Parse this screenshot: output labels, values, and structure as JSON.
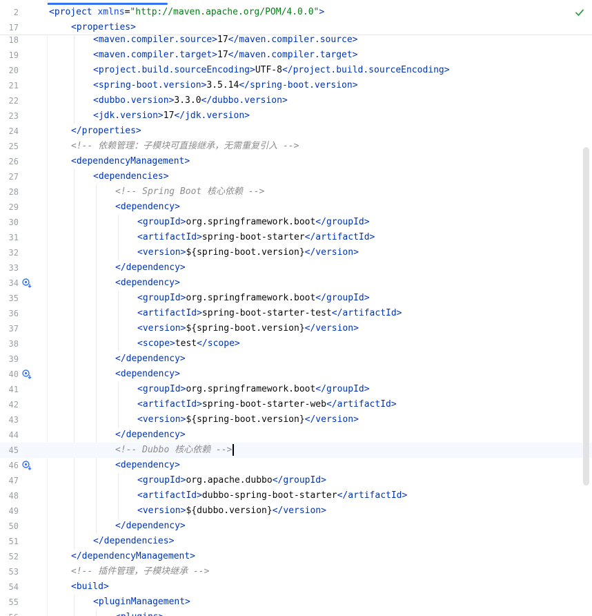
{
  "editor": {
    "status_icon": "check-icon",
    "sticky_lines": [
      {
        "number": "2",
        "indent": 0,
        "parts": [
          [
            "t",
            "<"
          ],
          [
            "t",
            "project"
          ],
          [
            "p",
            " "
          ],
          [
            "a",
            "xmlns"
          ],
          [
            "p",
            "="
          ],
          [
            "s",
            "\"http://maven.apache.org/POM/4.0.0\""
          ],
          [
            "t",
            ">"
          ]
        ]
      },
      {
        "number": "17",
        "indent": 1,
        "parts": [
          [
            "t",
            "<"
          ],
          [
            "t",
            "properties"
          ],
          [
            "t",
            ">"
          ]
        ]
      }
    ],
    "lines": [
      {
        "number": "18",
        "indent": 2,
        "parts": [
          [
            "t",
            "<maven.compiler.source>"
          ],
          [
            "p",
            "17"
          ],
          [
            "t",
            "</maven.compiler.source>"
          ]
        ]
      },
      {
        "number": "19",
        "indent": 2,
        "parts": [
          [
            "t",
            "<maven.compiler.target>"
          ],
          [
            "p",
            "17"
          ],
          [
            "t",
            "</maven.compiler.target>"
          ]
        ]
      },
      {
        "number": "20",
        "indent": 2,
        "parts": [
          [
            "t",
            "<project.build.sourceEncoding>"
          ],
          [
            "p",
            "UTF-8"
          ],
          [
            "t",
            "</project.build.sourceEncoding>"
          ]
        ]
      },
      {
        "number": "21",
        "indent": 2,
        "parts": [
          [
            "t",
            "<spring-boot.version>"
          ],
          [
            "p",
            "3.5.14"
          ],
          [
            "t",
            "</spring-boot.version>"
          ]
        ]
      },
      {
        "number": "22",
        "indent": 2,
        "parts": [
          [
            "t",
            "<dubbo.version>"
          ],
          [
            "p",
            "3.3.0"
          ],
          [
            "t",
            "</dubbo.version>"
          ]
        ]
      },
      {
        "number": "23",
        "indent": 2,
        "parts": [
          [
            "t",
            "<jdk.version>"
          ],
          [
            "p",
            "17"
          ],
          [
            "t",
            "</jdk.version>"
          ]
        ]
      },
      {
        "number": "24",
        "indent": 1,
        "parts": [
          [
            "t",
            "</properties>"
          ]
        ]
      },
      {
        "number": "25",
        "indent": 1,
        "parts": [
          [
            "c",
            "<!-- 依赖管理：子模块可直接继承，无需重复引入 -->"
          ]
        ]
      },
      {
        "number": "26",
        "indent": 1,
        "parts": [
          [
            "t",
            "<dependencyManagement>"
          ]
        ]
      },
      {
        "number": "27",
        "indent": 2,
        "parts": [
          [
            "t",
            "<dependencies>"
          ]
        ]
      },
      {
        "number": "28",
        "indent": 3,
        "parts": [
          [
            "c",
            "<!-- Spring Boot 核心依赖 -->"
          ]
        ]
      },
      {
        "number": "29",
        "indent": 3,
        "parts": [
          [
            "t",
            "<dependency>"
          ]
        ]
      },
      {
        "number": "30",
        "indent": 4,
        "parts": [
          [
            "t",
            "<groupId>"
          ],
          [
            "p",
            "org.springframework.boot"
          ],
          [
            "t",
            "</groupId>"
          ]
        ]
      },
      {
        "number": "31",
        "indent": 4,
        "parts": [
          [
            "t",
            "<artifactId>"
          ],
          [
            "p",
            "spring-boot-starter"
          ],
          [
            "t",
            "</artifactId>"
          ]
        ]
      },
      {
        "number": "32",
        "indent": 4,
        "parts": [
          [
            "t",
            "<version>"
          ],
          [
            "p",
            "${spring-boot.version}"
          ],
          [
            "t",
            "</version>"
          ]
        ]
      },
      {
        "number": "33",
        "indent": 3,
        "parts": [
          [
            "t",
            "</dependency>"
          ]
        ]
      },
      {
        "number": "34",
        "indent": 3,
        "gutter_icon": true,
        "parts": [
          [
            "t",
            "<dependency>"
          ]
        ]
      },
      {
        "number": "35",
        "indent": 4,
        "parts": [
          [
            "t",
            "<groupId>"
          ],
          [
            "p",
            "org.springframework.boot"
          ],
          [
            "t",
            "</groupId>"
          ]
        ]
      },
      {
        "number": "36",
        "indent": 4,
        "parts": [
          [
            "t",
            "<artifactId>"
          ],
          [
            "p",
            "spring-boot-starter-test"
          ],
          [
            "t",
            "</artifactId>"
          ]
        ]
      },
      {
        "number": "37",
        "indent": 4,
        "parts": [
          [
            "t",
            "<version>"
          ],
          [
            "p",
            "${spring-boot.version}"
          ],
          [
            "t",
            "</version>"
          ]
        ]
      },
      {
        "number": "38",
        "indent": 4,
        "parts": [
          [
            "t",
            "<scope>"
          ],
          [
            "p",
            "test"
          ],
          [
            "t",
            "</scope>"
          ]
        ]
      },
      {
        "number": "39",
        "indent": 3,
        "parts": [
          [
            "t",
            "</dependency>"
          ]
        ]
      },
      {
        "number": "40",
        "indent": 3,
        "gutter_icon": true,
        "parts": [
          [
            "t",
            "<dependency>"
          ]
        ]
      },
      {
        "number": "41",
        "indent": 4,
        "parts": [
          [
            "t",
            "<groupId>"
          ],
          [
            "p",
            "org.springframework.boot"
          ],
          [
            "t",
            "</groupId>"
          ]
        ]
      },
      {
        "number": "42",
        "indent": 4,
        "parts": [
          [
            "t",
            "<artifactId>"
          ],
          [
            "p",
            "spring-boot-starter-web"
          ],
          [
            "t",
            "</artifactId>"
          ]
        ]
      },
      {
        "number": "43",
        "indent": 4,
        "parts": [
          [
            "t",
            "<version>"
          ],
          [
            "p",
            "${spring-boot.version}"
          ],
          [
            "t",
            "</version>"
          ]
        ]
      },
      {
        "number": "44",
        "indent": 3,
        "parts": [
          [
            "t",
            "</dependency>"
          ]
        ]
      },
      {
        "number": "45",
        "indent": 3,
        "current": true,
        "parts": [
          [
            "c",
            "<!-- Dubbo 核心依赖 -->"
          ]
        ]
      },
      {
        "number": "46",
        "indent": 3,
        "gutter_icon": true,
        "parts": [
          [
            "t",
            "<dependency>"
          ]
        ]
      },
      {
        "number": "47",
        "indent": 4,
        "parts": [
          [
            "t",
            "<groupId>"
          ],
          [
            "p",
            "org.apache.dubbo"
          ],
          [
            "t",
            "</groupId>"
          ]
        ]
      },
      {
        "number": "48",
        "indent": 4,
        "parts": [
          [
            "t",
            "<artifactId>"
          ],
          [
            "p",
            "dubbo-spring-boot-starter"
          ],
          [
            "t",
            "</artifactId>"
          ]
        ]
      },
      {
        "number": "49",
        "indent": 4,
        "parts": [
          [
            "t",
            "<version>"
          ],
          [
            "p",
            "${dubbo.version}"
          ],
          [
            "t",
            "</version>"
          ]
        ]
      },
      {
        "number": "50",
        "indent": 3,
        "parts": [
          [
            "t",
            "</dependency>"
          ]
        ]
      },
      {
        "number": "51",
        "indent": 2,
        "parts": [
          [
            "t",
            "</dependencies>"
          ]
        ]
      },
      {
        "number": "52",
        "indent": 1,
        "parts": [
          [
            "t",
            "</dependencyManagement>"
          ]
        ]
      },
      {
        "number": "53",
        "indent": 1,
        "parts": [
          [
            "c",
            "<!-- 插件管理，子模块继承 -->"
          ]
        ]
      },
      {
        "number": "54",
        "indent": 1,
        "parts": [
          [
            "t",
            "<build>"
          ]
        ]
      },
      {
        "number": "55",
        "indent": 2,
        "parts": [
          [
            "t",
            "<pluginManagement>"
          ]
        ]
      },
      {
        "number": "56",
        "indent": 3,
        "parts": [
          [
            "t",
            "<plugins>"
          ]
        ]
      }
    ]
  },
  "colors": {
    "tag": "#0033b3",
    "string": "#067d17",
    "comment": "#8c8c8c",
    "current_line": "#f5f8fe",
    "accent": "#3574f0"
  }
}
